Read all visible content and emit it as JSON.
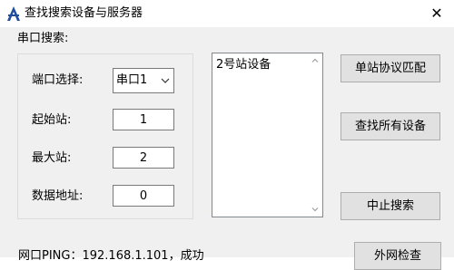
{
  "window": {
    "title": "查找搜索设备与服务器",
    "close_glyph": "✕"
  },
  "serial_search": {
    "section_label": "串口搜索:",
    "port": {
      "label": "端口选择:",
      "value": "串口1"
    },
    "start_station": {
      "label": "起始站:",
      "value": "1"
    },
    "max_station": {
      "label": "最大站:",
      "value": "2"
    },
    "data_address": {
      "label": "数据地址:",
      "value": "0"
    }
  },
  "device_list": {
    "items": [
      "2号站设备"
    ]
  },
  "buttons": {
    "single_match": "单站协议匹配",
    "find_all": "查找所有设备",
    "stop_search": "中止搜索",
    "external_check": "外网检查"
  },
  "status": {
    "text": "网口PING：192.168.1.101，成功"
  },
  "icons": {
    "app": "app-logo-icon",
    "close": "close-icon",
    "dropdown": "chevron-down-icon",
    "scroll_up": "scroll-up-icon",
    "scroll_down": "scroll-down-icon"
  },
  "colors": {
    "logo_blue": "#1e4e9c",
    "client_bg": "#f0f0f0",
    "button_bg": "#e1e1e1"
  }
}
